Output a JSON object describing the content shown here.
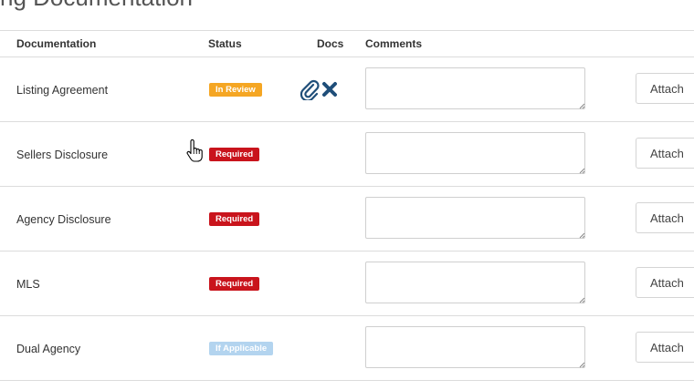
{
  "page": {
    "title": "ng Documentation"
  },
  "table": {
    "headers": {
      "documentation": "Documentation",
      "status": "Status",
      "docs": "Docs",
      "comments": "Comments"
    },
    "rows": [
      {
        "name": "Listing Agreement",
        "status": "In Review",
        "status_color": "#f5a623",
        "comment": "",
        "attach_label": "Attach",
        "has_doc": true
      },
      {
        "name": "Sellers Disclosure",
        "status": "Required",
        "status_color": "#c9141c",
        "comment": "",
        "attach_label": "Attach",
        "has_doc": false
      },
      {
        "name": "Agency Disclosure",
        "status": "Required",
        "status_color": "#c9141c",
        "comment": "",
        "attach_label": "Attach",
        "has_doc": false
      },
      {
        "name": "MLS",
        "status": "Required",
        "status_color": "#c9141c",
        "comment": "",
        "attach_label": "Attach",
        "has_doc": false
      },
      {
        "name": "Dual Agency",
        "status": "If Applicable",
        "status_color": "#b3d4ef",
        "comment": "",
        "attach_label": "Attach",
        "has_doc": false
      }
    ]
  },
  "icons": {
    "attachment": "paperclip-icon",
    "remove": "close-icon",
    "cursor": "hand-pointer-icon"
  },
  "colors": {
    "icon_blue": "#1f4e79"
  }
}
